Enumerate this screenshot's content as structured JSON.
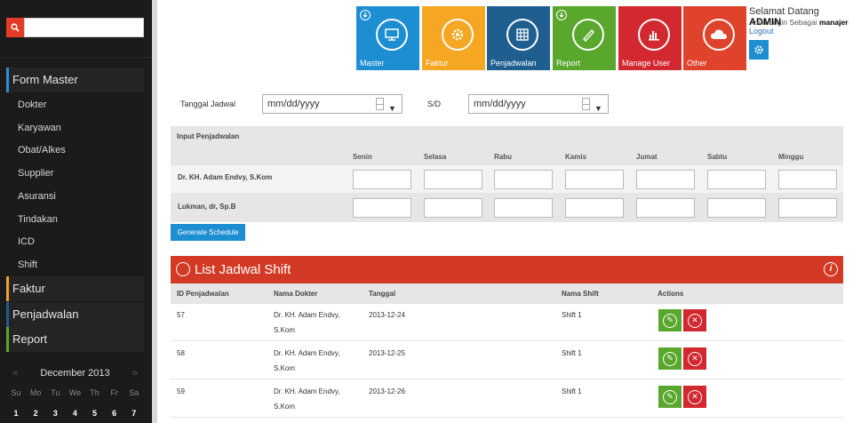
{
  "sidebar": {
    "search": {
      "placeholder": ""
    },
    "menu": [
      {
        "label": "Form Master",
        "color": "#2e8fd6",
        "items": [
          "Dokter",
          "Karyawan",
          "Obat/Alkes",
          "Supplier",
          "Asuransi",
          "Tindakan",
          "ICD",
          "Shift"
        ]
      },
      {
        "label": "Faktur",
        "color": "#f0a22e"
      },
      {
        "label": "Penjadwalan",
        "color": "#1e5f8f"
      },
      {
        "label": "Report",
        "color": "#5aa72e"
      }
    ],
    "calendar": {
      "prev": "«",
      "next": "»",
      "month": "December 2013",
      "days": [
        "Su",
        "Mo",
        "Tu",
        "We",
        "Th",
        "Fr",
        "Sa"
      ],
      "dates": [
        "1",
        "2",
        "3",
        "4",
        "5",
        "6",
        "7"
      ]
    }
  },
  "tiles": [
    {
      "label": "Master",
      "color": "#1e8ed2",
      "icon": "monitor-icon",
      "badge": true
    },
    {
      "label": "Faktur",
      "color": "#f5a623",
      "icon": "gear-icon",
      "badge": false
    },
    {
      "label": "Penjadwalan",
      "color": "#1e5f8f",
      "icon": "grid-icon",
      "badge": false
    },
    {
      "label": "Report",
      "color": "#5aa72e",
      "icon": "pen-icon",
      "badge": true
    },
    {
      "label": "Manage User",
      "color": "#d2282f",
      "icon": "chart-icon",
      "badge": false
    },
    {
      "label": "Other",
      "color": "#e0432c",
      "icon": "cloud-icon",
      "badge": false
    }
  ],
  "user": {
    "welcome_prefix": "Selamat Datang ",
    "name": "ADMIN",
    "role_prefix": "Anda Login Sebagai ",
    "role": "manajer",
    "logout": "Logout"
  },
  "filter": {
    "label": "Tanggal Jadwal",
    "from_value": "mm/dd/yyyy",
    "to_label": "S/D",
    "to_value": "mm/dd/yyyy"
  },
  "schedule_input": {
    "title": "Input Penjadwalan",
    "days": [
      "Senin",
      "Selasa",
      "Rabu",
      "Kamis",
      "Jumat",
      "Sabtu",
      "Minggu"
    ],
    "doctors": [
      "Dr. KH. Adam Endvy, S.Kom",
      "Lukman, dr, Sp.B"
    ],
    "button": "Generate Schedule"
  },
  "list": {
    "title": "List Jadwal Shift",
    "columns": [
      "ID Penjadwalan",
      "Nama Dokter",
      "Tanggal",
      "Nama Shift",
      "Actions"
    ],
    "rows": [
      {
        "id": "57",
        "doctor_line1": "Dr. KH. Adam Endvy,",
        "doctor_line2": "S.Kom",
        "date": "2013-12-24",
        "shift": "Shift 1"
      },
      {
        "id": "58",
        "doctor_line1": "Dr. KH. Adam Endvy,",
        "doctor_line2": "S.Kom",
        "date": "2013-12-25",
        "shift": "Shift 1"
      },
      {
        "id": "59",
        "doctor_line1": "Dr. KH. Adam Endvy,",
        "doctor_line2": "S.Kom",
        "date": "2013-12-26",
        "shift": "Shift 1"
      }
    ]
  }
}
